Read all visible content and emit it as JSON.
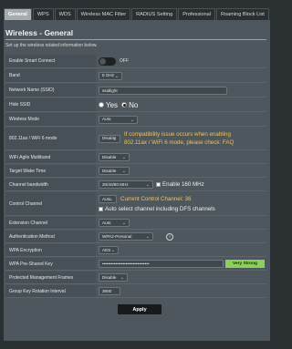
{
  "tabs": [
    "General",
    "WPS",
    "WDS",
    "Wireless MAC Filter",
    "RADIUS Setting",
    "Professional",
    "Roaming Block List"
  ],
  "page": {
    "title": "Wireless - General",
    "subtitle": "Set up the wireless related information below."
  },
  "fields": {
    "smart_connect": {
      "label": "Enable Smart Connect",
      "state": "OFF"
    },
    "band": {
      "label": "Band",
      "value": "5 GHz"
    },
    "ssid": {
      "label": "Network Name (SSID)",
      "value": "ssidlight"
    },
    "hide_ssid": {
      "label": "Hide SSID",
      "yes": "Yes",
      "no": "No",
      "selected": "No"
    },
    "wireless_mode": {
      "label": "Wireless Mode",
      "value": "Auto"
    },
    "ax_mode": {
      "label": "802.11ax / WiFi 6 mode",
      "value": "Disable",
      "note_line1": "If compatibility issue occurs when enabling",
      "note_line2": "802.11ax / WiFi 6 mode, please check:",
      "note_link": "FAQ"
    },
    "agile_multiband": {
      "label": "WiFi Agile Multiband",
      "value": "Disable"
    },
    "target_wake_time": {
      "label": "Target Wake Time",
      "value": "Disable"
    },
    "channel_bandwidth": {
      "label": "Channel bandwidth",
      "value": "20/40/80 MHz",
      "check_label": "Enable 160 MHz"
    },
    "control_channel": {
      "label": "Control Channel",
      "value": "Auto",
      "current": "Current Control Channel: 36",
      "dfs_label": "Auto select channel including DFS channels"
    },
    "extension_channel": {
      "label": "Extension Channel",
      "value": "Auto"
    },
    "auth_method": {
      "label": "Authentication Method",
      "value": "WPA2-Personal"
    },
    "wpa_encryption": {
      "label": "WPA Encryption",
      "value": "AES"
    },
    "wpa_key": {
      "label": "WPA Pre-Shared Key",
      "value": "••••••••••••••••••••••••••••••••",
      "strength": "Very Strong"
    },
    "pmf": {
      "label": "Protected Management Frames",
      "value": "Disable"
    },
    "group_key": {
      "label": "Group Key Rotation Interval",
      "value": "3600"
    }
  },
  "apply_label": "Apply",
  "colors": {
    "warning": "#f3c25b",
    "strength": "#8ad05a",
    "panel": "#4d575d"
  }
}
